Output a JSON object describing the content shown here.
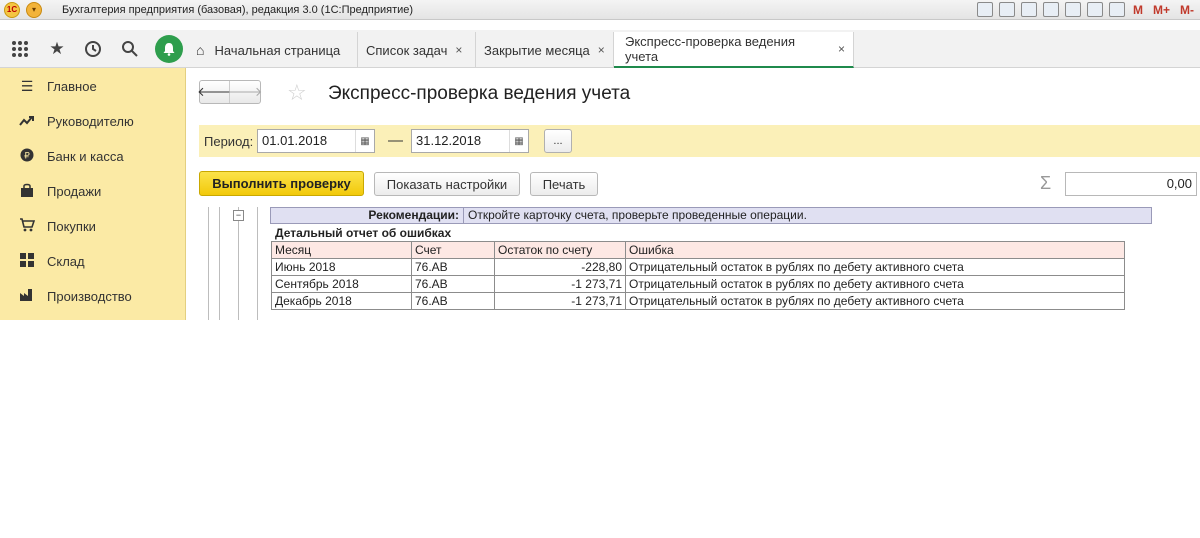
{
  "window": {
    "title": "Бухгалтерия предприятия (базовая), редакция 3.0  (1С:Предприятие)",
    "logo_text": "1С",
    "tool_m": "M",
    "tool_m_plus": "M+",
    "tool_m_minus": "M-"
  },
  "tabs": [
    {
      "label": "Начальная страница"
    },
    {
      "label": "Список задач",
      "close": "×"
    },
    {
      "label": "Закрытие месяца",
      "close": "×"
    },
    {
      "label": "Экспресс-проверка ведения учета",
      "close": "×"
    }
  ],
  "sidebar": {
    "items": [
      {
        "label": "Главное",
        "icon": "menu-icon"
      },
      {
        "label": "Руководителю",
        "icon": "trend-icon"
      },
      {
        "label": "Банк и касса",
        "icon": "ruble-icon"
      },
      {
        "label": "Продажи",
        "icon": "bag-icon"
      },
      {
        "label": "Покупки",
        "icon": "cart-icon"
      },
      {
        "label": "Склад",
        "icon": "grid-icon"
      },
      {
        "label": "Производство",
        "icon": "factory-icon"
      }
    ]
  },
  "page": {
    "title": "Экспресс-проверка ведения учета"
  },
  "period": {
    "label": "Период:",
    "from": "01.01.2018",
    "separator": "—",
    "to": "31.12.2018",
    "more_button": "..."
  },
  "toolbar": {
    "run_label": "Выполнить проверку",
    "settings_label": "Показать настройки",
    "print_label": "Печать",
    "sigma": "Σ",
    "sum_value": "0,00"
  },
  "report": {
    "collapse_symbol": "−",
    "recommendation_label": "Рекомендации:",
    "recommendation_text": "Откройте карточку счета, проверьте проведенные операции.",
    "detail_title": "Детальный отчет об ошибках",
    "columns": [
      "Месяц",
      "Счет",
      "Остаток по счету",
      "Ошибка"
    ],
    "rows": [
      [
        "Июнь 2018",
        "76.АВ",
        "-228,80",
        "Отрицательный остаток в рублях по дебету активного счета"
      ],
      [
        "Сентябрь 2018",
        "76.АВ",
        "-1 273,71",
        "Отрицательный остаток в рублях по дебету активного счета"
      ],
      [
        "Декабрь 2018",
        "76.АВ",
        "-1 273,71",
        "Отрицательный остаток в рублях по дебету активного счета"
      ]
    ]
  }
}
